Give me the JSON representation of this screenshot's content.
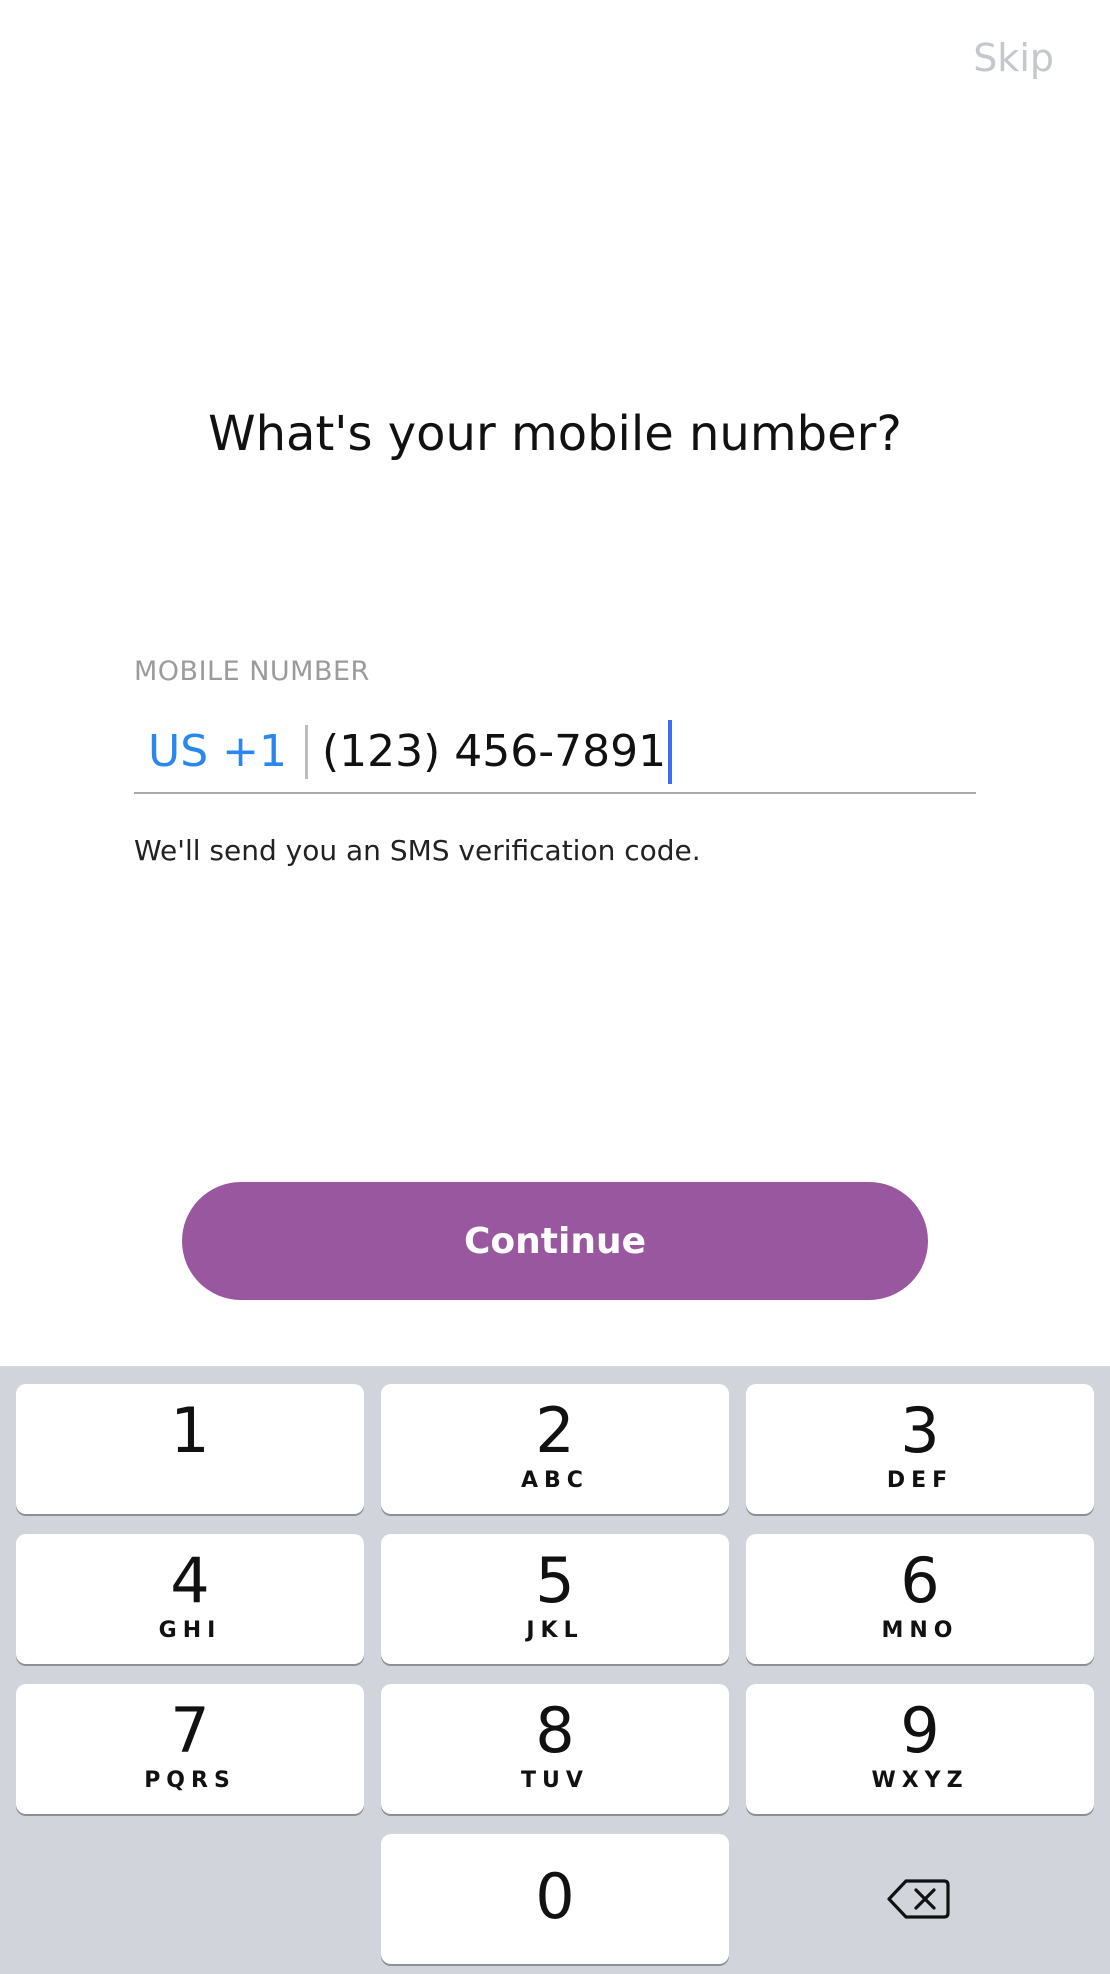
{
  "header": {
    "skip_label": "Skip"
  },
  "main": {
    "title": "What's your mobile number?",
    "field_label": "MOBILE NUMBER",
    "country_code": "US +1",
    "phone_value": "(123) 456-7891",
    "hint": "We'll send you an SMS verification code.",
    "continue_label": "Continue"
  },
  "keyboard": {
    "keys": [
      {
        "digit": "1",
        "letters": ""
      },
      {
        "digit": "2",
        "letters": "ABC"
      },
      {
        "digit": "3",
        "letters": "DEF"
      },
      {
        "digit": "4",
        "letters": "GHI"
      },
      {
        "digit": "5",
        "letters": "JKL"
      },
      {
        "digit": "6",
        "letters": "MNO"
      },
      {
        "digit": "7",
        "letters": "PQRS"
      },
      {
        "digit": "8",
        "letters": "TUV"
      },
      {
        "digit": "9",
        "letters": "WXYZ"
      },
      {
        "digit": "0",
        "letters": ""
      }
    ],
    "backspace_icon": "backspace-icon"
  },
  "colors": {
    "accent_purple": "#98579f",
    "country_code_blue": "#2a87f0",
    "caret_blue": "#3d6ef2",
    "keyboard_bg": "#d1d4db"
  }
}
